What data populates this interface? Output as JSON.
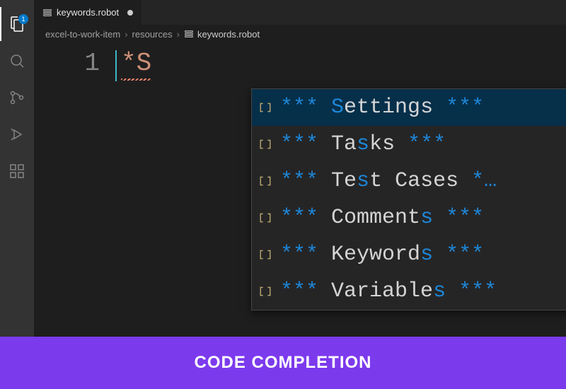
{
  "activityBar": {
    "explorerBadge": "1"
  },
  "tab": {
    "filename": "keywords.robot",
    "dirty": true
  },
  "breadcrumbs": {
    "items": [
      "excel-to-work-item",
      "resources"
    ],
    "last": "keywords.robot"
  },
  "editor": {
    "lineNumber": "1",
    "typedPrefix": "*",
    "typedChar": "S"
  },
  "suggestions": [
    {
      "stars": "***",
      "pad": " ",
      "pre": "",
      "match": "S",
      "post": "ettings ",
      "tail": "***"
    },
    {
      "stars": "***",
      "pad": " ",
      "pre": "Ta",
      "match": "s",
      "post": "ks ",
      "tail": "***"
    },
    {
      "stars": "***",
      "pad": " ",
      "pre": "Te",
      "match": "s",
      "post": "t Cases ",
      "tail": "*…"
    },
    {
      "stars": "***",
      "pad": " ",
      "pre": "Comment",
      "match": "s",
      "post": " ",
      "tail": "***"
    },
    {
      "stars": "***",
      "pad": " ",
      "pre": "Keyword",
      "match": "s",
      "post": " ",
      "tail": "***"
    },
    {
      "stars": "***",
      "pad": " ",
      "pre": "Variable",
      "match": "s",
      "post": " ",
      "tail": "***"
    }
  ],
  "banner": {
    "text": "CODE COMPLETION"
  }
}
